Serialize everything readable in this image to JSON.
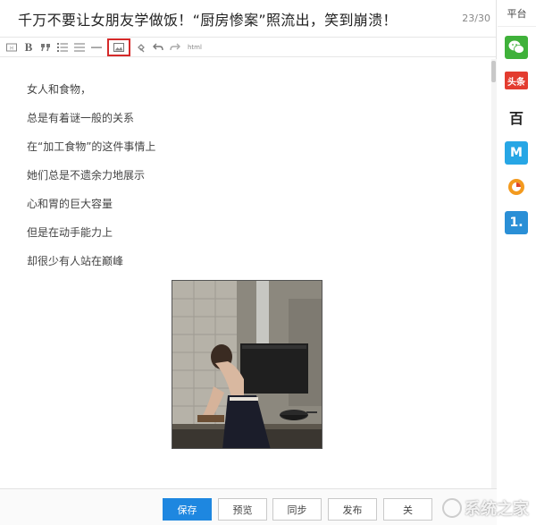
{
  "editor": {
    "title": "千万不要让女朋友学做饭！“厨房惨案”照流出，笑到崩溃！",
    "title_count": "23/30",
    "toolbar": {
      "icons": [
        "heading-icon",
        "bold-icon",
        "quote-icon",
        "ordered-list-icon",
        "unordered-list-icon",
        "horizontal-rule-icon",
        "image-icon",
        "link-icon",
        "undo-icon",
        "redo-icon"
      ],
      "bold_label": "B",
      "html_label": "html"
    },
    "lines": [
      "女人和食物，",
      "总是有着谜一般的关系",
      "在“加工食物”的这件事情上",
      "她们总是不遗余力地展示",
      "心和胃的巨大容量",
      "但是在动手能力上",
      "却很少有人站在巅峰"
    ]
  },
  "actions": {
    "save": "保存",
    "preview": "预览",
    "sync": "同步",
    "publish": "发布",
    "close": "关"
  },
  "platform": {
    "title": "平台",
    "items": [
      {
        "name": "wechat",
        "label": ""
      },
      {
        "name": "toutiao",
        "label": "头条"
      },
      {
        "name": "baijia",
        "label": "百"
      },
      {
        "name": "uc",
        "label": "M"
      },
      {
        "name": "dayu",
        "label": ""
      },
      {
        "name": "yidian",
        "label": "1."
      }
    ]
  },
  "watermark": "系统之家",
  "colors": {
    "primary": "#1e87e0",
    "selected_border": "#d52a2a",
    "wechat": "#3fb13a",
    "toutiao": "#e33c2f",
    "uc": "#27a6e5",
    "yidian": "#2a8fd6"
  }
}
